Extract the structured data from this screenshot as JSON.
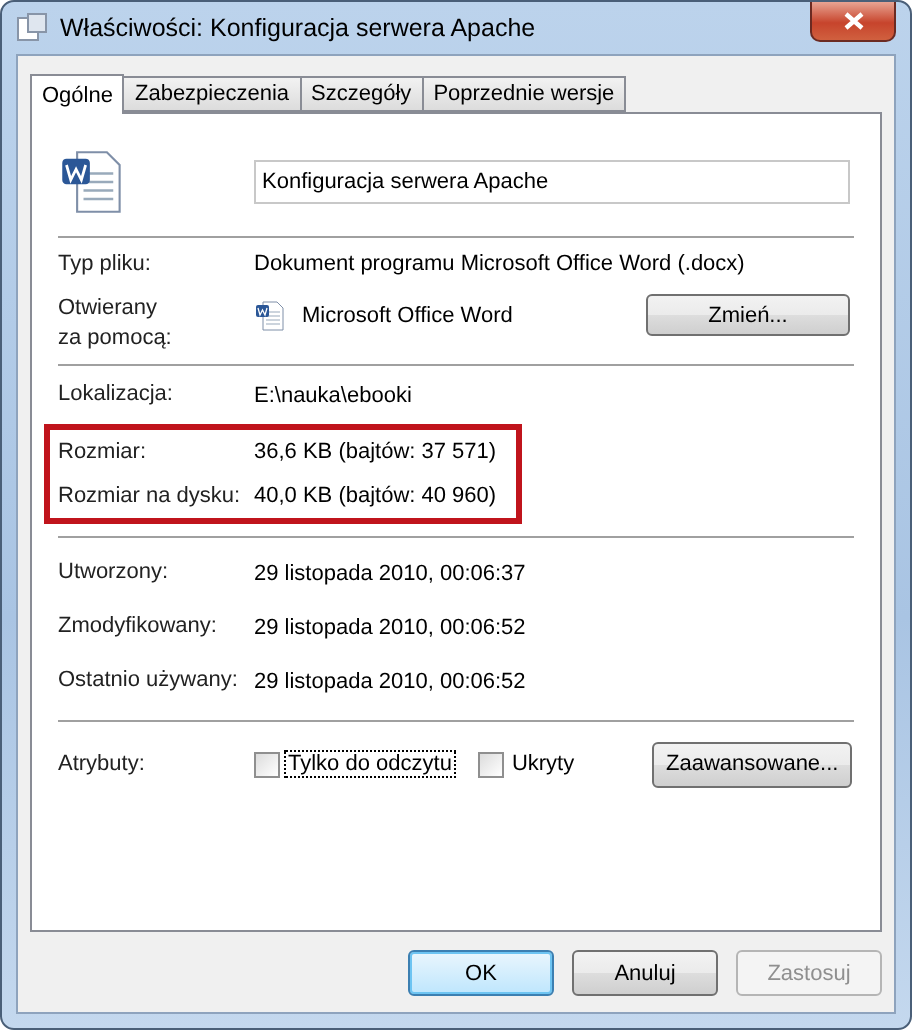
{
  "window": {
    "title": "Właściwości: Konfiguracja serwera Apache"
  },
  "tabs": [
    {
      "label": "Ogólne",
      "selected": true
    },
    {
      "label": "Zabezpieczenia",
      "selected": false
    },
    {
      "label": "Szczegóły",
      "selected": false
    },
    {
      "label": "Poprzednie wersje",
      "selected": false
    }
  ],
  "file_name": "Konfiguracja serwera Apache",
  "type": {
    "label": "Typ pliku:",
    "value": "Dokument programu Microsoft Office Word (.docx)"
  },
  "opens_with": {
    "label": "Otwierany\nza pomocą:",
    "value": "Microsoft Office Word",
    "button": "Zmień..."
  },
  "location": {
    "label": "Lokalizacja:",
    "value": "E:\\nauka\\ebooki"
  },
  "sizes": [
    {
      "label": "Rozmiar:",
      "value": "36,6 KB (bajtów: 37 571)"
    },
    {
      "label": "Rozmiar na dysku:",
      "value": "40,0 KB (bajtów: 40 960)"
    }
  ],
  "dates": [
    {
      "label": "Utworzony:",
      "value": "29 listopada 2010, 00:06:37"
    },
    {
      "label": "Zmodyfikowany:",
      "value": "29 listopada 2010, 00:06:52"
    },
    {
      "label": "Ostatnio używany:",
      "value": "29 listopada 2010, 00:06:52"
    }
  ],
  "attributes": {
    "label": "Atrybuty:",
    "checkboxes": [
      {
        "label": "Tylko do odczytu",
        "checked": false,
        "focused": true
      },
      {
        "label": "Ukryty",
        "checked": false,
        "focused": false
      }
    ],
    "button": "Zaawansowane..."
  },
  "buttons": [
    {
      "label": "OK",
      "default": true,
      "disabled": false
    },
    {
      "label": "Anuluj",
      "default": false,
      "disabled": false
    },
    {
      "label": "Zastosuj",
      "default": false,
      "disabled": true
    }
  ]
}
